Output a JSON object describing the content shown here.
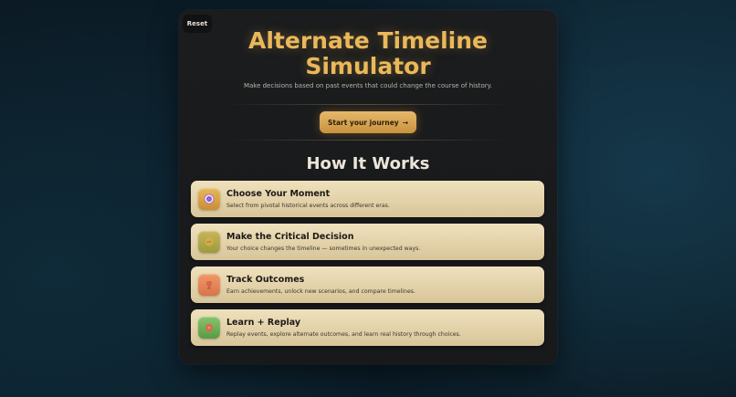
{
  "reset_label": "Reset",
  "hero": {
    "title_line1": "Alternate Timeline",
    "title_line2": "Simulator",
    "subtitle": "Make decisions based on past events that could change the course of history.",
    "start_label": "Start your journey",
    "start_arrow": "→"
  },
  "how_it_works": {
    "heading": "How It Works",
    "steps": [
      {
        "title": "Choose Your Moment",
        "description": "Select from pivotal historical events across different eras.",
        "icon": "target-icon",
        "color": "#d9a546"
      },
      {
        "title": "Make the Critical Decision",
        "description": "Your choice changes the timeline — sometimes in unexpected ways.",
        "icon": "decision-icon",
        "color": "#b8a64e"
      },
      {
        "title": "Track Outcomes",
        "description": "Earn achievements, unlock new scenarios, and compare timelines.",
        "icon": "trophy-icon",
        "color": "#e88a5a"
      },
      {
        "title": "Learn + Replay",
        "description": "Replay events, explore alternate outcomes, and learn real history through choices.",
        "icon": "replay-icon",
        "color": "#6cb05a"
      }
    ]
  }
}
